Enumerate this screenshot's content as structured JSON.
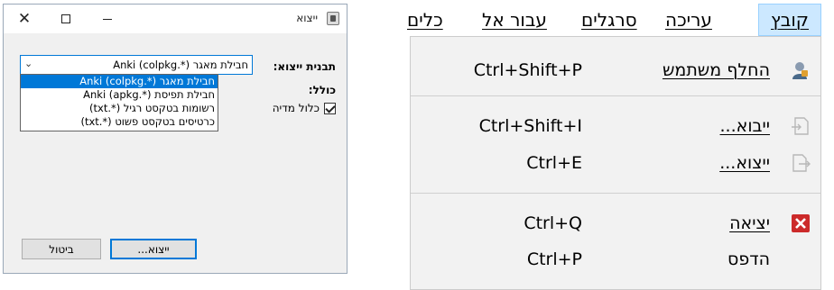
{
  "dialog": {
    "title": "ייצוא",
    "close_glyph": "✕",
    "format_label": "תבנית ייצוא:",
    "include_label": "כולל:",
    "selected_format": "חבילת מאגר (*.colpkg) Anki",
    "format_options": [
      "חבילת מאגר (*.colpkg) Anki",
      "חבילת תפיסת (*.apkg) Anki",
      "רשומות בטקסט רגיל (*.txt)",
      "כרטיסים בטקסט פשוט (*.txt)"
    ],
    "selected_option_index": 0,
    "include_media_label": "כלול מדיה",
    "include_media_checked": true,
    "export_button": "ייצוא...",
    "cancel_button": "ביטול",
    "icons": {
      "app": "anki-app-icon",
      "close": "close-icon",
      "maximize": "maximize-icon",
      "minimize": "minimize-icon",
      "dropdown": "chevron-down-icon",
      "checkbox": "checkmark-icon"
    }
  },
  "menubar": {
    "items": [
      "קובץ",
      "עריכה",
      "סרגלים",
      "עבור אל",
      "כלים"
    ],
    "active_index": 0
  },
  "file_menu": {
    "items": [
      {
        "label": "החלף משתמש",
        "shortcut": "Ctrl+Shift+P",
        "icon": "switch-user-icon",
        "underline": true
      },
      {
        "label": "ייבוא...",
        "shortcut": "Ctrl+Shift+I",
        "icon": "import-icon",
        "underline": true
      },
      {
        "label": "ייצוא...",
        "shortcut": "Ctrl+E",
        "icon": "export-icon",
        "underline": true
      },
      {
        "label": "יציאה",
        "shortcut": "Ctrl+Q",
        "icon": "exit-icon",
        "underline": true
      },
      {
        "label": "הדפס",
        "shortcut": "Ctrl+P",
        "icon": "",
        "underline": false
      }
    ]
  },
  "colors": {
    "accent": "#0078d7",
    "menu_active_bg": "#cce8ff",
    "exit_icon": "#cc2a2a"
  }
}
